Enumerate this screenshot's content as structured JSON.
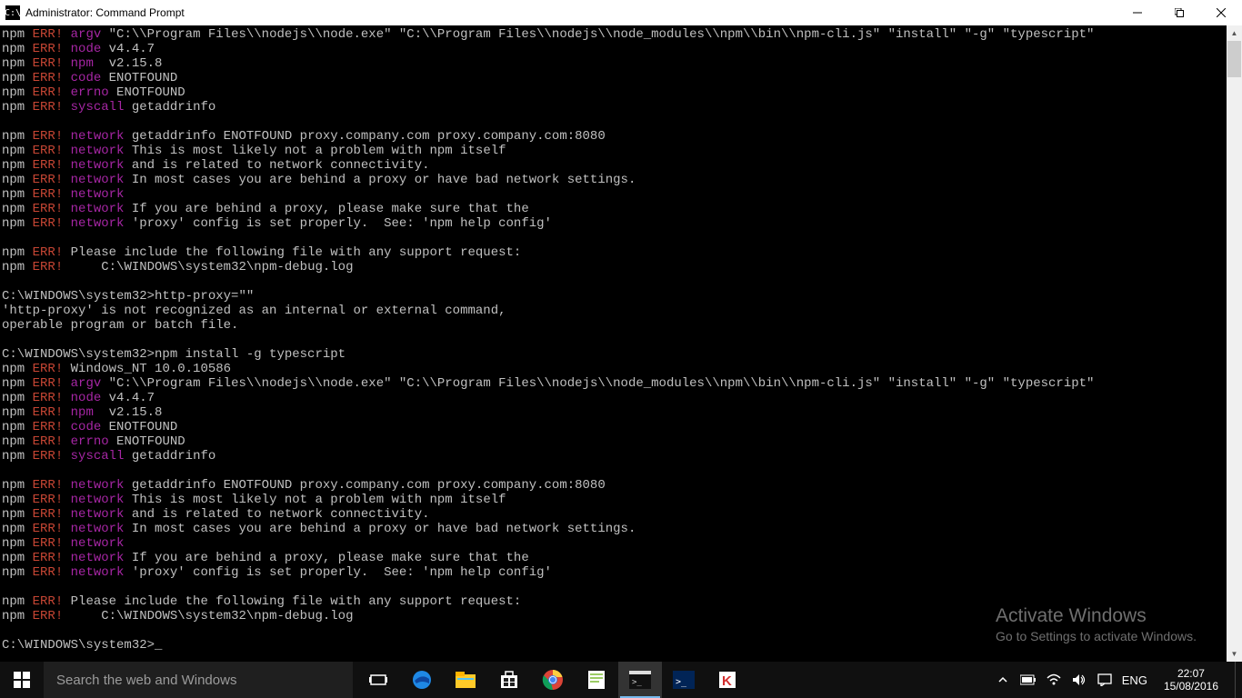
{
  "title": "Administrator: Command Prompt",
  "watermark": {
    "line1": "Activate Windows",
    "line2": "Go to Settings to activate Windows."
  },
  "search_placeholder": "Search the web and Windows",
  "tray_lang": "ENG",
  "clock_time": "22:07",
  "clock_date": "15/08/2016",
  "lines": [
    [
      [
        "w",
        "npm"
      ],
      [
        "r",
        " ERR! "
      ],
      [
        "m",
        "argv"
      ],
      [
        "w",
        " \"C:\\\\Program Files\\\\nodejs\\\\node.exe\" \"C:\\\\Program Files\\\\nodejs\\\\node_modules\\\\npm\\\\bin\\\\npm-cli.js\" \"install\" \"-g\" \"typescript\""
      ]
    ],
    [
      [
        "w",
        "npm"
      ],
      [
        "r",
        " ERR! "
      ],
      [
        "m",
        "node"
      ],
      [
        "w",
        " v4.4.7"
      ]
    ],
    [
      [
        "w",
        "npm"
      ],
      [
        "r",
        " ERR! "
      ],
      [
        "m",
        "npm "
      ],
      [
        "w",
        " v2.15.8"
      ]
    ],
    [
      [
        "w",
        "npm"
      ],
      [
        "r",
        " ERR! "
      ],
      [
        "m",
        "code"
      ],
      [
        "w",
        " ENOTFOUND"
      ]
    ],
    [
      [
        "w",
        "npm"
      ],
      [
        "r",
        " ERR! "
      ],
      [
        "m",
        "errno"
      ],
      [
        "w",
        " ENOTFOUND"
      ]
    ],
    [
      [
        "w",
        "npm"
      ],
      [
        "r",
        " ERR! "
      ],
      [
        "m",
        "syscall"
      ],
      [
        "w",
        " getaddrinfo"
      ]
    ],
    [
      [
        "w",
        " "
      ]
    ],
    [
      [
        "w",
        "npm"
      ],
      [
        "r",
        " ERR! "
      ],
      [
        "m",
        "network"
      ],
      [
        "w",
        " getaddrinfo ENOTFOUND proxy.company.com proxy.company.com:8080"
      ]
    ],
    [
      [
        "w",
        "npm"
      ],
      [
        "r",
        " ERR! "
      ],
      [
        "m",
        "network"
      ],
      [
        "w",
        " This is most likely not a problem with npm itself"
      ]
    ],
    [
      [
        "w",
        "npm"
      ],
      [
        "r",
        " ERR! "
      ],
      [
        "m",
        "network"
      ],
      [
        "w",
        " and is related to network connectivity."
      ]
    ],
    [
      [
        "w",
        "npm"
      ],
      [
        "r",
        " ERR! "
      ],
      [
        "m",
        "network"
      ],
      [
        "w",
        " In most cases you are behind a proxy or have bad network settings."
      ]
    ],
    [
      [
        "w",
        "npm"
      ],
      [
        "r",
        " ERR! "
      ],
      [
        "m",
        "network"
      ],
      [
        "w",
        ""
      ]
    ],
    [
      [
        "w",
        "npm"
      ],
      [
        "r",
        " ERR! "
      ],
      [
        "m",
        "network"
      ],
      [
        "w",
        " If you are behind a proxy, please make sure that the"
      ]
    ],
    [
      [
        "w",
        "npm"
      ],
      [
        "r",
        " ERR! "
      ],
      [
        "m",
        "network"
      ],
      [
        "w",
        " 'proxy' config is set properly.  See: 'npm help config'"
      ]
    ],
    [
      [
        "w",
        " "
      ]
    ],
    [
      [
        "w",
        "npm"
      ],
      [
        "r",
        " ERR!"
      ],
      [
        "w",
        " Please include the following file with any support request:"
      ]
    ],
    [
      [
        "w",
        "npm"
      ],
      [
        "r",
        " ERR!"
      ],
      [
        "w",
        "     C:\\WINDOWS\\system32\\npm-debug.log"
      ]
    ],
    [
      [
        "w",
        " "
      ]
    ],
    [
      [
        "w",
        "C:\\WINDOWS\\system32>http-proxy=\"\""
      ]
    ],
    [
      [
        "w",
        "'http-proxy' is not recognized as an internal or external command,"
      ]
    ],
    [
      [
        "w",
        "operable program or batch file."
      ]
    ],
    [
      [
        "w",
        " "
      ]
    ],
    [
      [
        "w",
        "C:\\WINDOWS\\system32>npm install -g typescript"
      ]
    ],
    [
      [
        "w",
        "npm"
      ],
      [
        "r",
        " ERR!"
      ],
      [
        "w",
        " Windows_NT 10.0.10586"
      ]
    ],
    [
      [
        "w",
        "npm"
      ],
      [
        "r",
        " ERR! "
      ],
      [
        "m",
        "argv"
      ],
      [
        "w",
        " \"C:\\\\Program Files\\\\nodejs\\\\node.exe\" \"C:\\\\Program Files\\\\nodejs\\\\node_modules\\\\npm\\\\bin\\\\npm-cli.js\" \"install\" \"-g\" \"typescript\""
      ]
    ],
    [
      [
        "w",
        "npm"
      ],
      [
        "r",
        " ERR! "
      ],
      [
        "m",
        "node"
      ],
      [
        "w",
        " v4.4.7"
      ]
    ],
    [
      [
        "w",
        "npm"
      ],
      [
        "r",
        " ERR! "
      ],
      [
        "m",
        "npm "
      ],
      [
        "w",
        " v2.15.8"
      ]
    ],
    [
      [
        "w",
        "npm"
      ],
      [
        "r",
        " ERR! "
      ],
      [
        "m",
        "code"
      ],
      [
        "w",
        " ENOTFOUND"
      ]
    ],
    [
      [
        "w",
        "npm"
      ],
      [
        "r",
        " ERR! "
      ],
      [
        "m",
        "errno"
      ],
      [
        "w",
        " ENOTFOUND"
      ]
    ],
    [
      [
        "w",
        "npm"
      ],
      [
        "r",
        " ERR! "
      ],
      [
        "m",
        "syscall"
      ],
      [
        "w",
        " getaddrinfo"
      ]
    ],
    [
      [
        "w",
        " "
      ]
    ],
    [
      [
        "w",
        "npm"
      ],
      [
        "r",
        " ERR! "
      ],
      [
        "m",
        "network"
      ],
      [
        "w",
        " getaddrinfo ENOTFOUND proxy.company.com proxy.company.com:8080"
      ]
    ],
    [
      [
        "w",
        "npm"
      ],
      [
        "r",
        " ERR! "
      ],
      [
        "m",
        "network"
      ],
      [
        "w",
        " This is most likely not a problem with npm itself"
      ]
    ],
    [
      [
        "w",
        "npm"
      ],
      [
        "r",
        " ERR! "
      ],
      [
        "m",
        "network"
      ],
      [
        "w",
        " and is related to network connectivity."
      ]
    ],
    [
      [
        "w",
        "npm"
      ],
      [
        "r",
        " ERR! "
      ],
      [
        "m",
        "network"
      ],
      [
        "w",
        " In most cases you are behind a proxy or have bad network settings."
      ]
    ],
    [
      [
        "w",
        "npm"
      ],
      [
        "r",
        " ERR! "
      ],
      [
        "m",
        "network"
      ],
      [
        "w",
        ""
      ]
    ],
    [
      [
        "w",
        "npm"
      ],
      [
        "r",
        " ERR! "
      ],
      [
        "m",
        "network"
      ],
      [
        "w",
        " If you are behind a proxy, please make sure that the"
      ]
    ],
    [
      [
        "w",
        "npm"
      ],
      [
        "r",
        " ERR! "
      ],
      [
        "m",
        "network"
      ],
      [
        "w",
        " 'proxy' config is set properly.  See: 'npm help config'"
      ]
    ],
    [
      [
        "w",
        " "
      ]
    ],
    [
      [
        "w",
        "npm"
      ],
      [
        "r",
        " ERR!"
      ],
      [
        "w",
        " Please include the following file with any support request:"
      ]
    ],
    [
      [
        "w",
        "npm"
      ],
      [
        "r",
        " ERR!"
      ],
      [
        "w",
        "     C:\\WINDOWS\\system32\\npm-debug.log"
      ]
    ],
    [
      [
        "w",
        " "
      ]
    ],
    [
      [
        "w",
        "C:\\WINDOWS\\system32>_"
      ]
    ]
  ],
  "task_icons": [
    "taskview",
    "edge",
    "explorer",
    "store",
    "chrome",
    "notepadpp",
    "cmd",
    "powershell",
    "kaspersky"
  ]
}
